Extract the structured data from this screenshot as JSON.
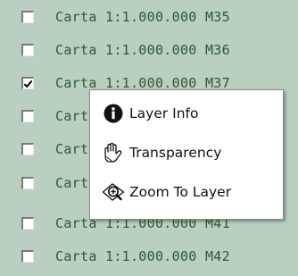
{
  "layers": [
    {
      "label": "Carta 1:1.000.000 M35",
      "checked": false
    },
    {
      "label": "Carta 1:1.000.000 M36",
      "checked": false
    },
    {
      "label": "Carta 1:1.000.000 M37",
      "checked": true
    },
    {
      "label": "Carta 1:1.000.000 M38",
      "checked": false
    },
    {
      "label": "Carta 1:1.000.000 M39",
      "checked": false
    },
    {
      "label": "Carta 1:1.000.000 M40",
      "checked": false
    },
    {
      "label": "Carta 1:1.000.000 M41",
      "checked": false
    },
    {
      "label": "Carta 1:1.000.000 M42",
      "checked": false
    }
  ],
  "context_menu": {
    "items": [
      {
        "label": "Layer Info",
        "icon": "info-icon"
      },
      {
        "label": "Transparency",
        "icon": "transparency-hand-icon"
      },
      {
        "label": "Zoom To Layer",
        "icon": "zoom-to-layer-icon"
      }
    ]
  },
  "colors": {
    "panel_background": "#b9cfc0",
    "label_text": "#2c5a34",
    "menu_background": "#ffffff"
  }
}
